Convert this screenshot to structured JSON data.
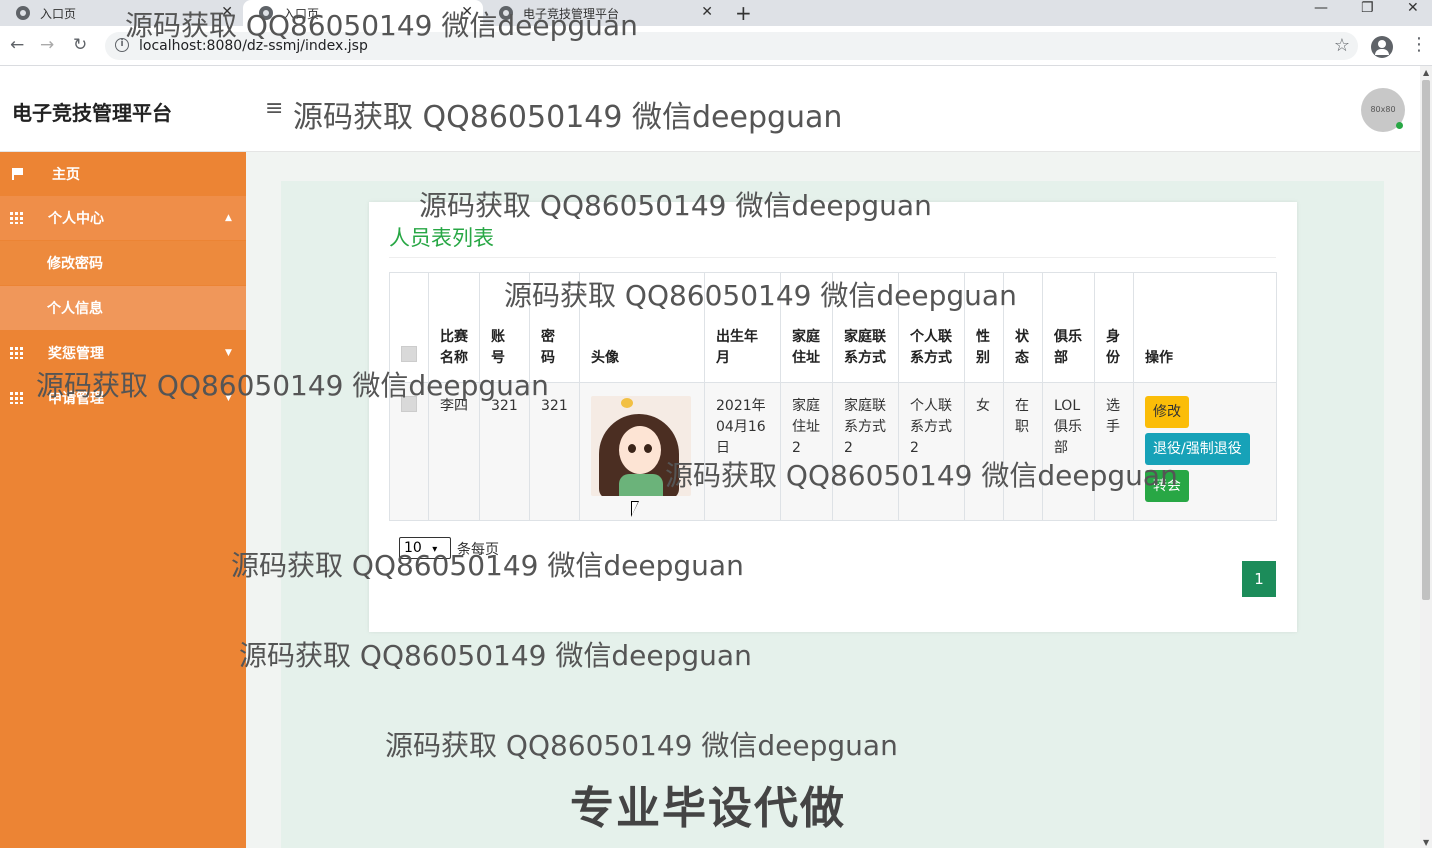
{
  "browser": {
    "tabs": [
      {
        "title": "入口页"
      },
      {
        "title": "入口页"
      },
      {
        "title": "电子竞技管理平台"
      }
    ],
    "url": "localhost:8080/dz-ssmj/index.jsp"
  },
  "header": {
    "brand": "电子竞技管理平台",
    "avatar_text": "80x80"
  },
  "sidebar": {
    "items": [
      {
        "label": "主页"
      },
      {
        "label": "个人中心"
      },
      {
        "label": "修改密码"
      },
      {
        "label": "个人信息"
      },
      {
        "label": "奖惩管理"
      },
      {
        "label": "申请管理"
      }
    ]
  },
  "main": {
    "title": "人员表列表",
    "columns": [
      "比赛名称",
      "账号",
      "密码",
      "头像",
      "出生年月",
      "家庭住址",
      "家庭联系方式",
      "个人联系方式",
      "性别",
      "状态",
      "俱乐部",
      "身份",
      "操作"
    ],
    "rows": [
      {
        "match_name": "李四",
        "account": "321",
        "password": "321",
        "birth": "2021年04月16日",
        "address": "家庭住址2",
        "home_contact": "家庭联系方式2",
        "personal_contact": "个人联系方式2",
        "gender": "女",
        "status": "在职",
        "club": "LOL俱乐部",
        "role": "选手",
        "actions": {
          "edit": "修改",
          "retire": "退役/强制退役",
          "transfer": "转会"
        }
      }
    ],
    "pager": {
      "page_size": "10",
      "per_page_label": "条每页",
      "current_page": "1"
    }
  },
  "watermarks": {
    "text": "源码获取 QQ86050149 微信deepguan",
    "big": "专业毕设代做"
  },
  "colors": {
    "sidebar": "#ec8434",
    "accent": "#28a745",
    "page_active": "#1c8c5a"
  }
}
